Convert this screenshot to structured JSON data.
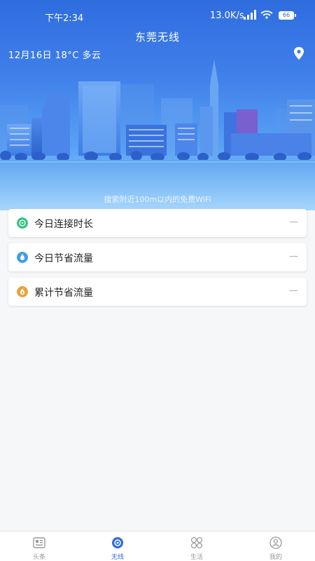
{
  "status_bar": {
    "time": "下午2:34",
    "network_speed": "13.0K/s",
    "battery": "66"
  },
  "header": {
    "title": "东莞无线",
    "weather": "12月16日  18°C 多云",
    "location_icon": "location-pin-icon",
    "hint": "搜索附近100m以内的免费WiFi"
  },
  "cards": [
    {
      "label": "今日连接时长",
      "value": "—",
      "icon": "clock-icon",
      "color": "#33c27f"
    },
    {
      "label": "今日节省流量",
      "value": "—",
      "icon": "droplet-icon",
      "color": "#3aa0e6"
    },
    {
      "label": "累计节省流量",
      "value": "—",
      "icon": "flame-icon",
      "color": "#e9a23b"
    }
  ],
  "bottom_nav": [
    {
      "label": "头条",
      "icon": "news-icon",
      "active": false
    },
    {
      "label": "无线",
      "icon": "wifi-disc-icon",
      "active": true
    },
    {
      "label": "生活",
      "icon": "grid-icon",
      "active": false
    },
    {
      "label": "我的",
      "icon": "profile-icon",
      "active": false
    }
  ],
  "colors": {
    "primary": "#2f6ddf",
    "hero_light": "#9fd0fb"
  }
}
